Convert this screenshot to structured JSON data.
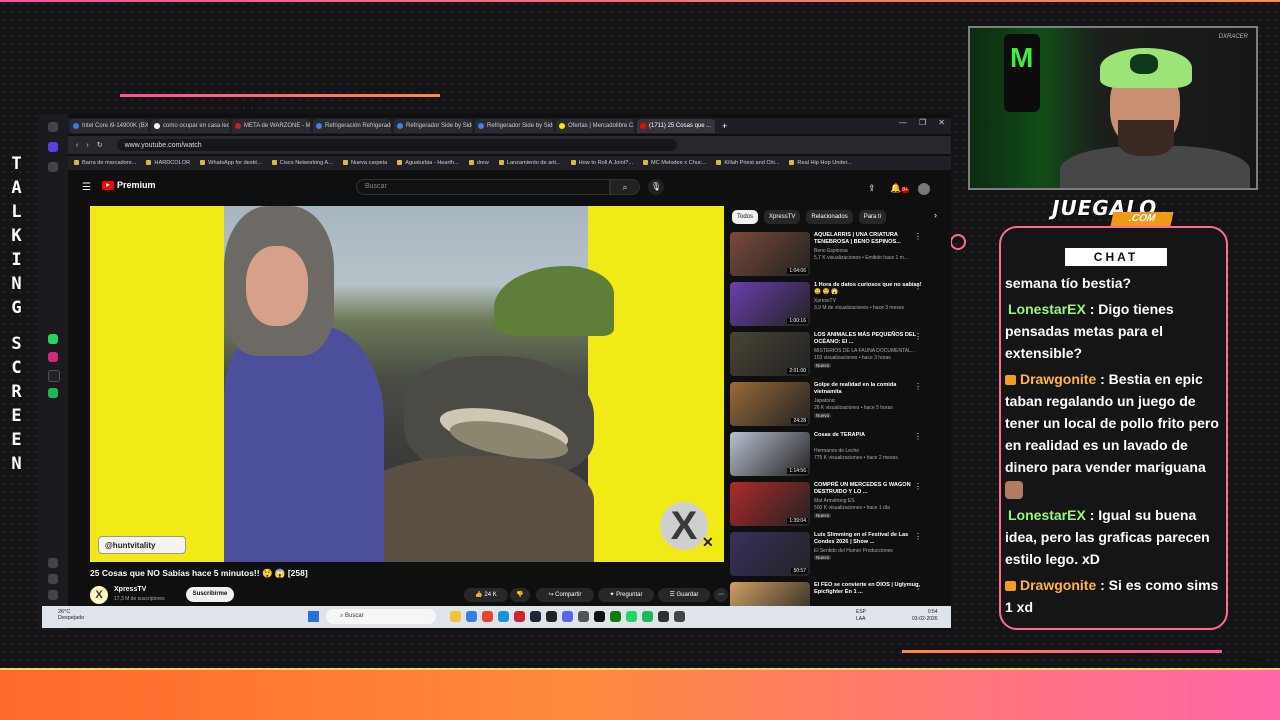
{
  "overlay": {
    "vertical_text": "TALKING SCREEN",
    "brand": "JUEGALO",
    "brand_sub": ".COM",
    "cam_tag": "DXRACER"
  },
  "browser": {
    "tabs": [
      {
        "label": "Intel Core i9-14900K (BX8...",
        "color": "#3b7be8"
      },
      {
        "label": "como ocupar en casa lec...",
        "color": "#ffffff"
      },
      {
        "label": "META de WARZONE - Mi...",
        "color": "#c0252b"
      },
      {
        "label": "Refrigeración Refrigerado...",
        "color": "#4a7de0"
      },
      {
        "label": "Refrigerador Side by Side...",
        "color": "#4a7de0"
      },
      {
        "label": "Refrigerador Side by Side...",
        "color": "#4a7de0"
      },
      {
        "label": "Ofertas | Mercadolibre C...",
        "color": "#ffe600"
      },
      {
        "label": "(1711) 25 Cosas que ...",
        "color": "#ff0000"
      }
    ],
    "url": "www.youtube.com/watch",
    "bookmarks": [
      "Barra de marcadore...",
      "HARDCOLOR",
      "WhatsApp for deskt...",
      "Cisco Networking A...",
      "Nueva carpeta",
      "Aguaturbia - Hearth...",
      "drew",
      "Lanzamiento de arti...",
      "How to Roll A Joint?...",
      "MC Melodee x Chuc...",
      "Killah Priest and Chi...",
      "Real Hip Hop Under..."
    ]
  },
  "youtube": {
    "logo_label": "Premium",
    "search_placeholder": "Buscar",
    "notif_count": "9+",
    "watermark": "@huntvitality",
    "video_title": "25 Cosas que NO Sabías hace 5 minutos!! 😲 😱 [258]",
    "channel": "XpressTV",
    "channel_initial": "X",
    "subscribers": "17,3 M de suscriptores",
    "subscribe": "Suscribirme",
    "likes": "24 K",
    "share": "Compartir",
    "ask": "Preguntar",
    "save": "Guardar",
    "chips": [
      "Todos",
      "XpressTV",
      "Relacionados",
      "Para ti"
    ],
    "recommendations": [
      {
        "title": "AQUELARRIS | UNA CRIATURA TENEBROSA | BENO ESPINOS...",
        "channel": "Beno Espinosa",
        "meta": "5,7 K visualizaciones • Emitido hace 1 m...",
        "duration": "1:04:06",
        "badge": "",
        "thumb": "#7a4a3a"
      },
      {
        "title": "1 Hora de datos curiosos que no sabías! 🤤 😲 😱",
        "channel": "XpressTV",
        "meta": "3,9 M de visualizaciones • hace 3 meses",
        "duration": "1:00:16",
        "badge": "",
        "thumb": "#6a3fb0"
      },
      {
        "title": "LOS ANIMALES MÁS PEQUEÑOS DEL OCÉANO: El ...",
        "channel": "MISTERIOS DE LA FAUNA DOCUMENTAL...",
        "meta": "103 visualizaciones • hace 3 horas",
        "duration": "2:01:00",
        "badge": "Nuevo",
        "thumb": "#4a4436"
      },
      {
        "title": "Golpe de realidad en la comida vietnamita",
        "channel": "Japatonic",
        "meta": "26 K visualizaciones • hace 5 horas",
        "duration": "24:28",
        "badge": "Nuevo",
        "thumb": "#9a6a3a"
      },
      {
        "title": "Cosas de TERAPIA",
        "channel": "Hermanos de Leche",
        "meta": "775 K visualizaciones • hace 2 meses",
        "duration": "1:14:56",
        "badge": "",
        "thumb": "#b8c0d0"
      },
      {
        "title": "COMPRÉ UN MERCEDES G WAGON DESTRUIDO Y LO ...",
        "channel": "Mat Armstrong ES",
        "meta": "500 K visualizaciones • hace 1 día",
        "duration": "1:39:04",
        "badge": "Nuevo",
        "thumb": "#b02a2a"
      },
      {
        "title": "Luis Slimming en el Festival de Las Condes 2026 | Show ...",
        "channel": "El Sentido del Humor Producciones",
        "meta": "",
        "duration": "50:57",
        "badge": "Nuevo",
        "thumb": "#3a3060"
      },
      {
        "title": "El FEO se convierte en DIOS | Uglymug, Epicfighter En 1 ...",
        "channel": "",
        "meta": "",
        "duration": "",
        "badge": "",
        "thumb": "#d0a060"
      }
    ]
  },
  "taskbar": {
    "weather": "26°C",
    "weather_desc": "Despejado",
    "search": "Buscar",
    "lang": "ESP",
    "lang_sub": "LAA",
    "time": "0:54",
    "date": "03-02-2026"
  },
  "chat": {
    "title": "CHAT",
    "messages": [
      {
        "user": "",
        "text": "semana tío bestia?"
      },
      {
        "user": "LonestarEX",
        "text": " : Digo tienes pensadas metas para el extensible?"
      },
      {
        "user": "Drawgonite",
        "text": " : Bestia en epic taban regalando un juego de tener un local de pollo frito pero en realidad es un lavado de dinero para vender mariguana"
      },
      {
        "user": "LonestarEX",
        "text": " : Igual su buena idea, pero las graficas parecen estilo lego. xD"
      },
      {
        "user": "Drawgonite",
        "text": " : Si es como sims 1 xd"
      }
    ]
  }
}
